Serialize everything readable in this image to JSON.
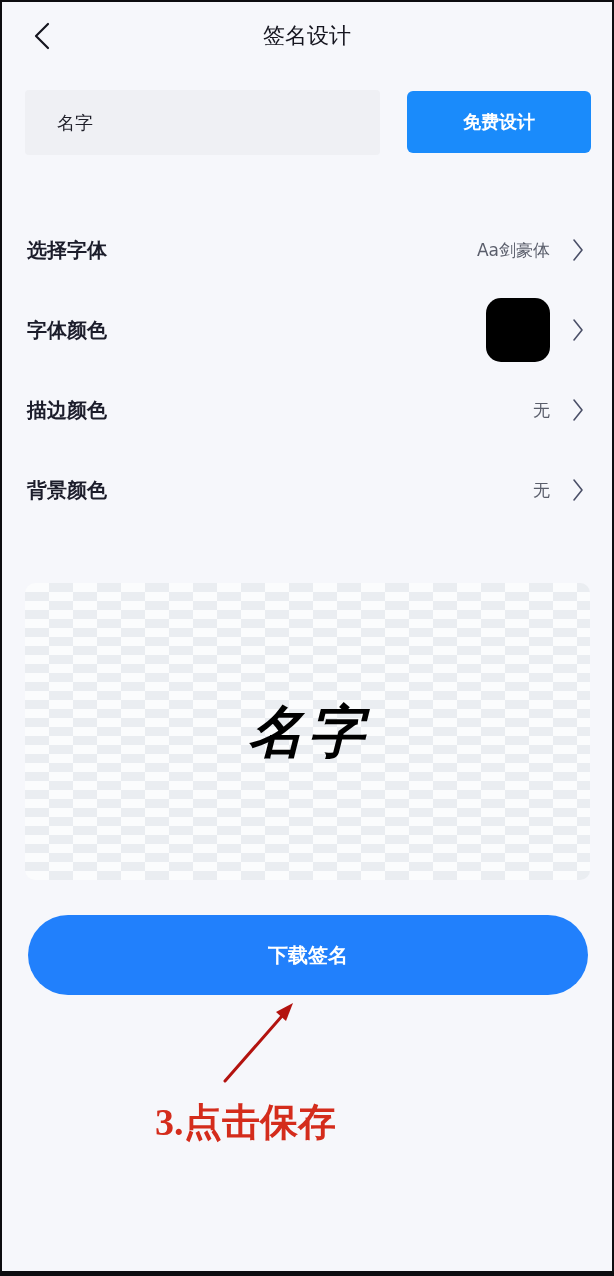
{
  "header": {
    "title": "签名设计"
  },
  "name_input": {
    "value": "名字"
  },
  "design_button": {
    "label": "免费设计"
  },
  "settings": [
    {
      "kind": "text",
      "label": "选择字体",
      "value": "Aa剑豪体"
    },
    {
      "kind": "swatch",
      "label": "字体颜色",
      "color": "#000000"
    },
    {
      "kind": "text",
      "label": "描边颜色",
      "value": "无"
    },
    {
      "kind": "text",
      "label": "背景颜色",
      "value": "无"
    }
  ],
  "preview": {
    "signature": "名字"
  },
  "download_button": {
    "label": "下载签名"
  },
  "annotation": {
    "text": "3.点击保存"
  }
}
